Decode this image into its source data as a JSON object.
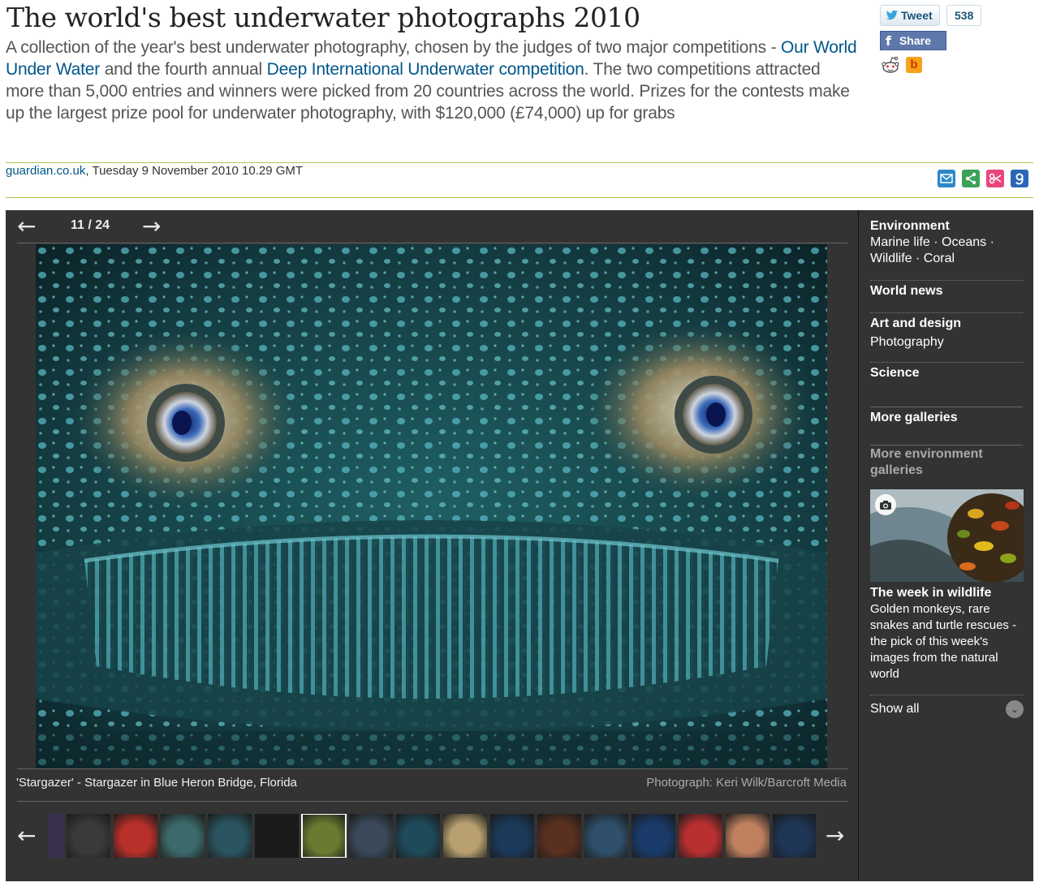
{
  "article": {
    "headline": "The world's best underwater photographs 2010",
    "standfirst_part1": "A collection of the year's best underwater photography, chosen by the judges of two major competitions - ",
    "link1": "Our World Under Water",
    "standfirst_part2": " and the fourth annual ",
    "link2": "Deep International Underwater competition",
    "standfirst_part3": ". The two competitions attracted more than 5,000 entries and winners were picked from 20 countries across the world. Prizes for the contests make up the largest prize pool for underwater photography, with $120,000 (£74,000) up for grabs",
    "byline_source": "guardian.co.uk",
    "byline_date": ", Tuesday 9 November 2010 10.29 GMT"
  },
  "social": {
    "tweet_label": "Tweet",
    "tweet_count": "538",
    "share_label": "Share",
    "share_glyph": "f",
    "buzz_glyph": "b",
    "icons": [
      "twitter-bird-icon",
      "facebook-icon",
      "reddit-icon",
      "buzz-icon"
    ]
  },
  "tools": [
    {
      "name": "email-icon",
      "color": "#2b87c8"
    },
    {
      "name": "share-icon",
      "color": "#3aa257"
    },
    {
      "name": "clip-icon",
      "color": "#e8467c"
    },
    {
      "name": "google-icon",
      "color": "#2c67b5"
    }
  ],
  "gallery": {
    "counter": "11 / 24",
    "prev_glyph": "←",
    "next_glyph": "→",
    "caption": "'Stargazer' - Stargazer in Blue Heron Bridge, Florida",
    "credit": "Photograph: Keri Wilk/Barcroft Media",
    "thumbnail_count": 16,
    "active_thumbnail": 5,
    "thumb_colors": [
      "#2a3d4f",
      "#3a3a3a",
      "#b8302a",
      "#3c6a6a",
      "#2a5560",
      "#1a1a1a",
      "#6a7a30",
      "#3a4a5a",
      "#1f4a5a",
      "#b8a070",
      "#1b3a5a",
      "#5a3020",
      "#2f4f6a",
      "#1a3a6a",
      "#b83030",
      "#c08060",
      "#1e3555"
    ]
  },
  "sidebar": {
    "environment_title": "Environment",
    "environment_links_1": "Marine life · Oceans ·",
    "environment_links_2": "Wildlife · Coral",
    "world_news": "World news",
    "art_title": "Art and design",
    "art_link": "Photography",
    "science": "Science",
    "more_galleries": "More galleries",
    "more_env_1": "More environment",
    "more_env_2": "galleries",
    "promo_title": "The week in wildlife",
    "promo_text": "Golden monkeys, rare snakes and turtle rescues - the pick of this week's images from the natural world",
    "show_all": "Show all",
    "show_all_glyph": "⌄"
  },
  "colors": {
    "accent_link": "#005689",
    "rule_green": "#a8c84b",
    "gallery_bg": "#333333"
  }
}
